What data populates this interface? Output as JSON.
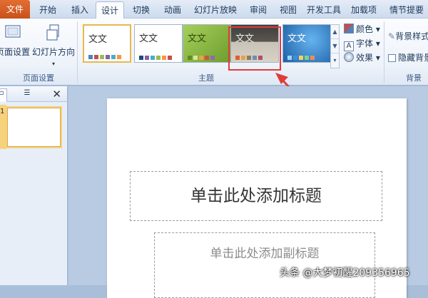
{
  "tabs": [
    {
      "label": "文件"
    },
    {
      "label": "开始"
    },
    {
      "label": "插入"
    },
    {
      "label": "设计"
    },
    {
      "label": "切换"
    },
    {
      "label": "动画"
    },
    {
      "label": "幻灯片放映"
    },
    {
      "label": "审阅"
    },
    {
      "label": "视图"
    },
    {
      "label": "开发工具"
    },
    {
      "label": "加载项"
    },
    {
      "label": "情节提要"
    }
  ],
  "ribbon": {
    "page_setup": {
      "btn1": "页面设置",
      "btn2": "幻灯片方向",
      "group": "页面设置"
    },
    "themes": {
      "group": "主题",
      "items": [
        {
          "text": "文文",
          "bg": "#ffffff",
          "fg": "#333333",
          "selected": true
        },
        {
          "text": "文文",
          "bg": "#ffffff",
          "fg": "#333333",
          "selected": false
        },
        {
          "text": "文文",
          "bg": "#8fbf45",
          "fg": "#2d4a12",
          "selected": false
        },
        {
          "text": "文文",
          "bg": "#5a5752",
          "fg": "#f0eee8",
          "selected": false
        },
        {
          "text": "文文",
          "bg": "#2b79c4",
          "fg": "#ffffff",
          "selected": false
        }
      ],
      "colors": "颜色",
      "fonts": "字体",
      "effects": "效果"
    },
    "background": {
      "styles": "背景样式",
      "hide": "隐藏背景",
      "group": "背景"
    }
  },
  "slide": {
    "title_placeholder": "单击此处添加标题",
    "subtitle_placeholder": "单击此处添加副标题",
    "number": "1"
  },
  "watermark": "头条 @大梦初醒209356965",
  "colors": {
    "accent_red": "#e03c3c",
    "file_tab": "#d45a22"
  }
}
